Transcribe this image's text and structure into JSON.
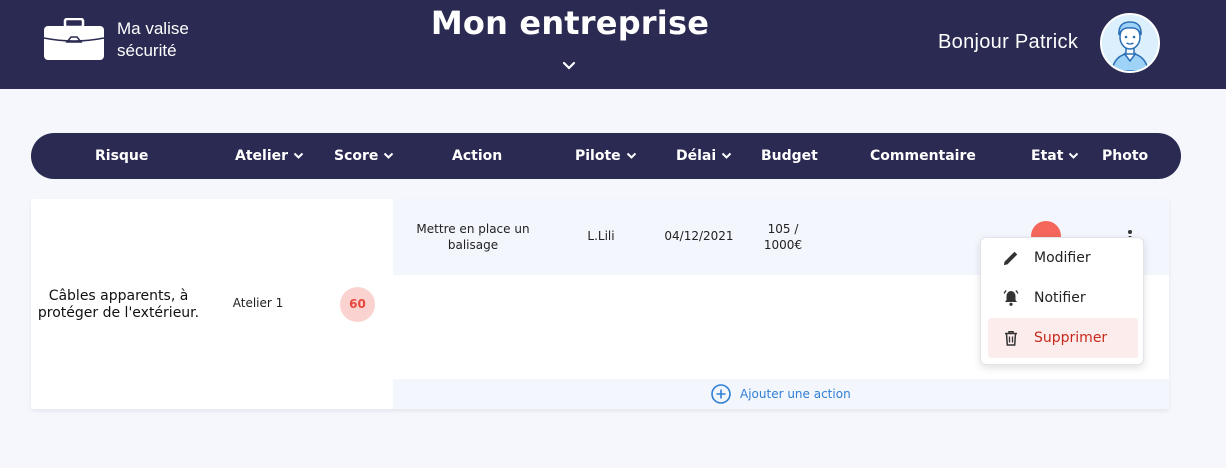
{
  "header": {
    "app_name": "Ma valise sécurité",
    "company": "Mon entreprise",
    "greeting": "Bonjour Patrick"
  },
  "table": {
    "columns": [
      {
        "label": "Risque",
        "sortable": false
      },
      {
        "label": "Atelier",
        "sortable": true
      },
      {
        "label": "Score",
        "sortable": true
      },
      {
        "label": "Action",
        "sortable": false
      },
      {
        "label": "Pilote",
        "sortable": true
      },
      {
        "label": "Délai",
        "sortable": true
      },
      {
        "label": "Budget",
        "sortable": false
      },
      {
        "label": "Commentaire",
        "sortable": false
      },
      {
        "label": "Etat",
        "sortable": true
      },
      {
        "label": "Photo",
        "sortable": false
      }
    ],
    "row": {
      "risk": "Câbles apparents, à protéger de l'extérieur.",
      "workshop": "Atelier 1",
      "score": "60",
      "action": "Mettre en place un balisage",
      "pilot": "L.Lili",
      "deadline": "04/12/2021",
      "budget": "105 / 1000€",
      "state_color": "#f4675a",
      "add_action_label": "Ajouter une action"
    }
  },
  "context_menu": {
    "items": [
      {
        "label": "Modifier",
        "icon": "pencil-icon"
      },
      {
        "label": "Notifier",
        "icon": "bell-icon"
      },
      {
        "label": "Supprimer",
        "icon": "trash-icon",
        "danger": true
      }
    ]
  },
  "colors": {
    "navy": "#2a2a52",
    "danger": "#c6281c",
    "link": "#2f7fd6"
  }
}
